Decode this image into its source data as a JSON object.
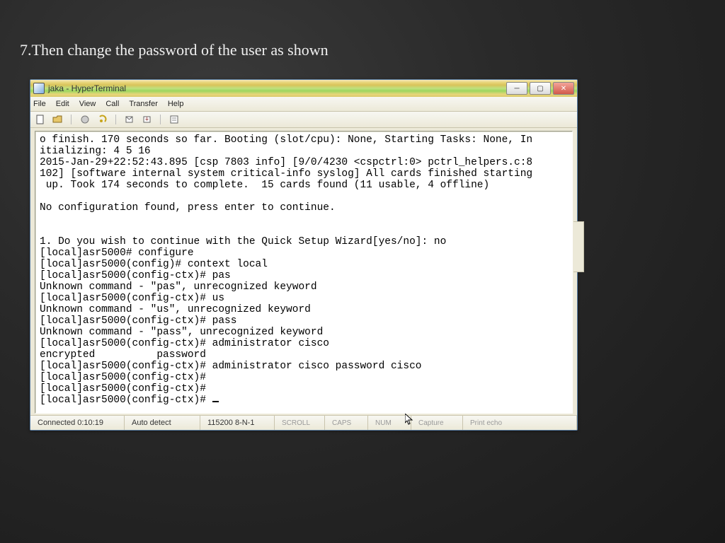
{
  "slide": {
    "title": "7.Then change the password of the user as shown"
  },
  "window": {
    "title": "jaka - HyperTerminal",
    "menu": {
      "file": "File",
      "edit": "Edit",
      "view": "View",
      "call": "Call",
      "transfer": "Transfer",
      "help": "Help"
    }
  },
  "terminal": {
    "lines": [
      "o finish. 170 seconds so far. Booting (slot/cpu): None, Starting Tasks: None, In",
      "itializing: 4 5 16",
      "2015-Jan-29+22:52:43.895 [csp 7803 info] [9/0/4230 <cspctrl:0> pctrl_helpers.c:8",
      "102] [software internal system critical-info syslog] All cards finished starting",
      " up. Took 174 seconds to complete.  15 cards found (11 usable, 4 offline)",
      "",
      "No configuration found, press enter to continue.",
      "",
      "",
      "1. Do you wish to continue with the Quick Setup Wizard[yes/no]: no",
      "[local]asr5000# configure",
      "[local]asr5000(config)# context local",
      "[local]asr5000(config-ctx)# pas",
      "Unknown command - \"pas\", unrecognized keyword",
      "[local]asr5000(config-ctx)# us",
      "Unknown command - \"us\", unrecognized keyword",
      "[local]asr5000(config-ctx)# pass",
      "Unknown command - \"pass\", unrecognized keyword",
      "[local]asr5000(config-ctx)# administrator cisco",
      "encrypted          password",
      "[local]asr5000(config-ctx)# administrator cisco password cisco",
      "[local]asr5000(config-ctx)#",
      "[local]asr5000(config-ctx)#",
      "[local]asr5000(config-ctx)# "
    ]
  },
  "status": {
    "conn": "Connected 0:10:19",
    "detect": "Auto detect",
    "params": "115200 8-N-1",
    "scroll": "SCROLL",
    "caps": "CAPS",
    "num": "NUM",
    "capture": "Capture",
    "echo": "Print echo"
  }
}
